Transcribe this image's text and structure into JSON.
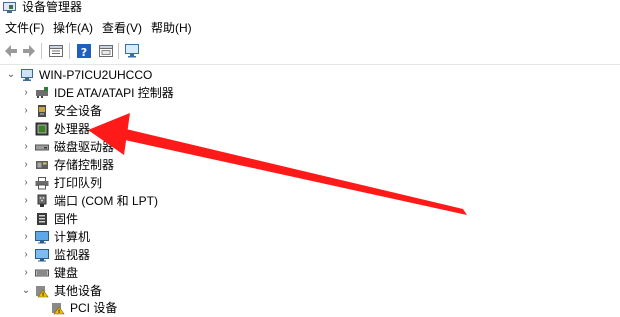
{
  "window": {
    "title": "设备管理器"
  },
  "menu": {
    "file": "文件(F)",
    "action": "操作(A)",
    "view": "查看(V)",
    "help": "帮助(H)"
  },
  "tree": {
    "root": "WIN-P7ICU2UHCCO",
    "items": [
      {
        "label": "IDE ATA/ATAPI 控制器"
      },
      {
        "label": "安全设备"
      },
      {
        "label": "处理器"
      },
      {
        "label": "磁盘驱动器"
      },
      {
        "label": "存储控制器"
      },
      {
        "label": "打印队列"
      },
      {
        "label": "端口 (COM 和 LPT)"
      },
      {
        "label": "固件"
      },
      {
        "label": "计算机"
      },
      {
        "label": "监视器"
      },
      {
        "label": "键盘"
      },
      {
        "label": "其他设备"
      },
      {
        "label": "PCI 设备"
      }
    ]
  },
  "annotation": {
    "color": "#ff1a1a"
  }
}
